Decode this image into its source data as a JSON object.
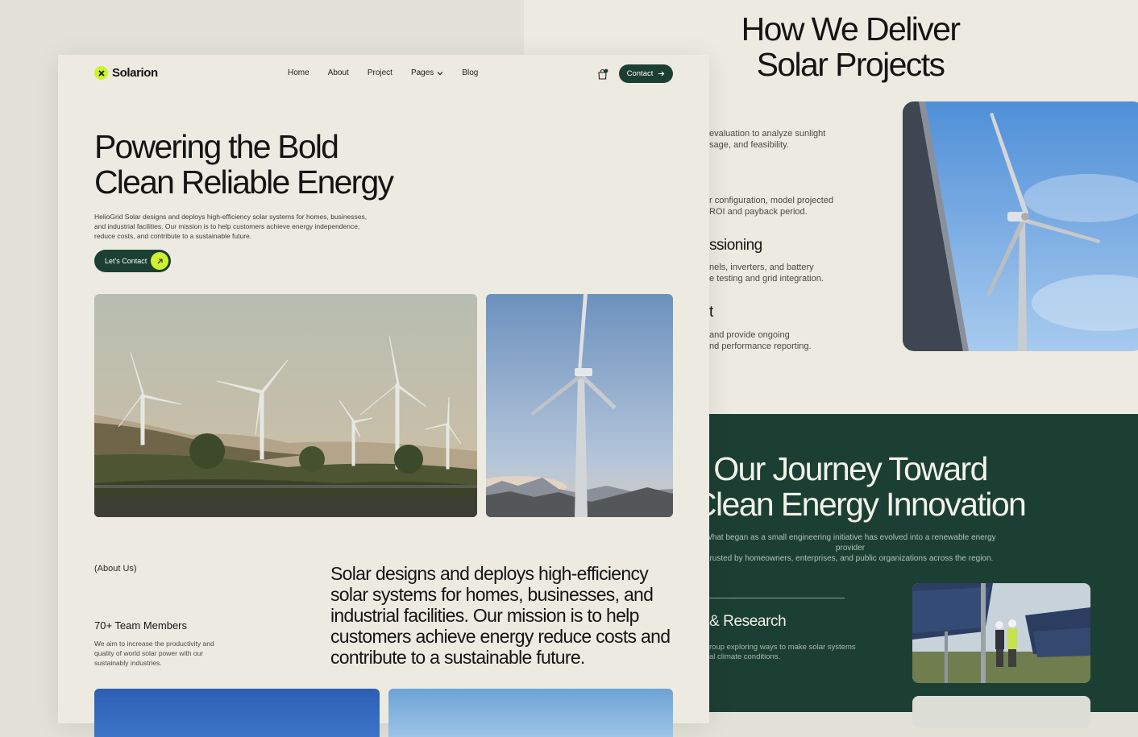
{
  "right_top": {
    "title_line1": "How We Deliver",
    "title_line2": "Solar Projects",
    "steps": [
      {
        "line1": "evaluation to analyze sunlight",
        "line2": "sage, and feasibility."
      },
      {
        "line1": "r configuration, model projected",
        "line2": "ROI and payback period."
      },
      {
        "title": "ssioning",
        "line1": "nels, inverters, and battery",
        "line2": "e testing and grid integration."
      },
      {
        "title": "t",
        "line1": "and provide ongoing",
        "line2": "nd performance reporting."
      }
    ]
  },
  "journey": {
    "title_line1": "Our Journey Toward",
    "title_line2": "Clean Energy Innovation",
    "subtitle_line1": "What began as a small engineering initiative has evolved into a renewable energy provider",
    "subtitle_line2": "trusted by homeowners, enterprises, and public organizations across the region.",
    "item_title": "& Research",
    "item_line1": "roup exploring ways to make solar systems",
    "item_line2": "al climate conditions."
  },
  "header": {
    "logo": "Solarion",
    "nav": [
      "Home",
      "About",
      "Project",
      "Pages",
      "Blog"
    ],
    "contact": "Contact"
  },
  "hero": {
    "title_line1": "Powering the Bold",
    "title_line2": "Clean Reliable Energy",
    "text": "HelioGrid Solar designs and deploys high-efficiency solar systems for homes, businesses, and industrial facilities. Our mission is to help customers achieve energy independence, reduce costs, and contribute to a sustainable future.",
    "cta": "Let's Contact"
  },
  "about": {
    "label": "(About Us)",
    "team_title": "70+ Team Members",
    "team_text": "We aim to increase the productivity and quality of world solar power with our sustainably industries.",
    "paragraph": "Solar designs and deploys high-efficiency solar systems for homes, businesses, and industrial facilities. Our mission is to help customers achieve energy reduce costs and contribute to a sustainable future."
  },
  "colors": {
    "accent": "#cdf230",
    "dark_green": "#1c3f33",
    "page_bg": "#edebe1"
  }
}
